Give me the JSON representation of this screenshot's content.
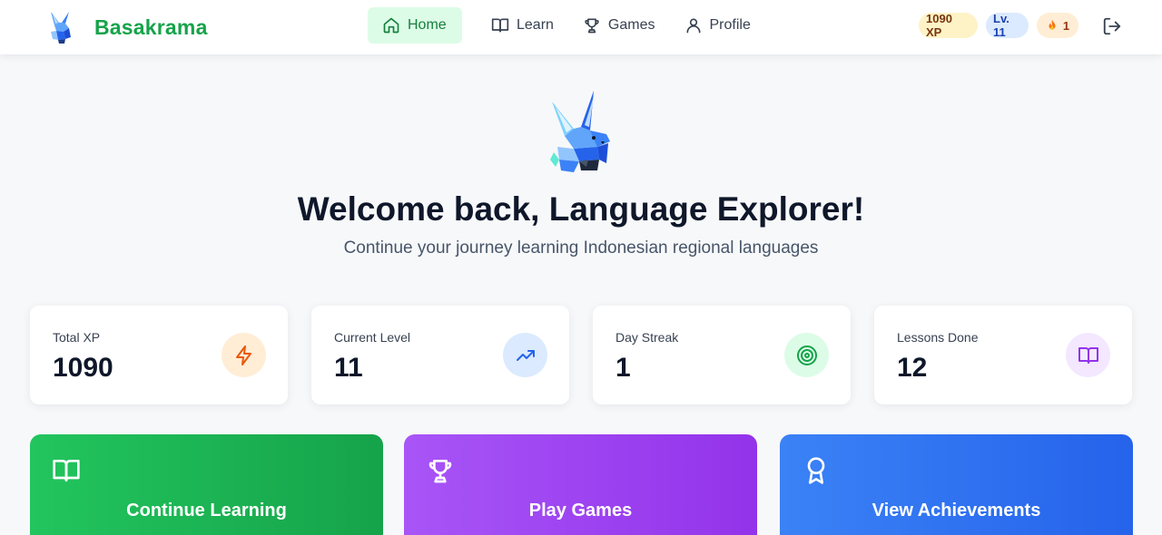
{
  "brand": {
    "name": "Basakrama",
    "logo_icon": "fox-mascot-icon"
  },
  "nav": {
    "items": [
      {
        "label": "Home",
        "icon": "home-icon",
        "active": true
      },
      {
        "label": "Learn",
        "icon": "book-icon",
        "active": false
      },
      {
        "label": "Games",
        "icon": "trophy-icon",
        "active": false
      },
      {
        "label": "Profile",
        "icon": "user-icon",
        "active": false
      }
    ]
  },
  "user_stats": {
    "xp": "1090 XP",
    "level": "Lv. 11",
    "streak": "1",
    "streak_icon": "fire-icon"
  },
  "logout_icon": "logout-icon",
  "hero": {
    "title": "Welcome back, Language Explorer!",
    "subtitle": "Continue your journey learning Indonesian regional languages"
  },
  "stats": [
    {
      "label": "Total XP",
      "value": "1090",
      "icon": "lightning-icon",
      "color": "#ea580c",
      "bg": "#ffedd5"
    },
    {
      "label": "Current Level",
      "value": "11",
      "icon": "trending-up-icon",
      "color": "#2563eb",
      "bg": "#dbeafe"
    },
    {
      "label": "Day Streak",
      "value": "1",
      "icon": "target-icon",
      "color": "#16a34a",
      "bg": "#dcfce7"
    },
    {
      "label": "Lessons Done",
      "value": "12",
      "icon": "book-icon",
      "color": "#9333ea",
      "bg": "#f3e8ff"
    }
  ],
  "actions": [
    {
      "label": "Continue Learning",
      "icon": "book-icon",
      "color": "#16a34a"
    },
    {
      "label": "Play Games",
      "icon": "trophy-icon",
      "color": "#9333ea"
    },
    {
      "label": "View Achievements",
      "icon": "award-icon",
      "color": "#2563eb"
    }
  ],
  "colors": {
    "brand": "#16a34a",
    "background": "#f7f8fa"
  }
}
